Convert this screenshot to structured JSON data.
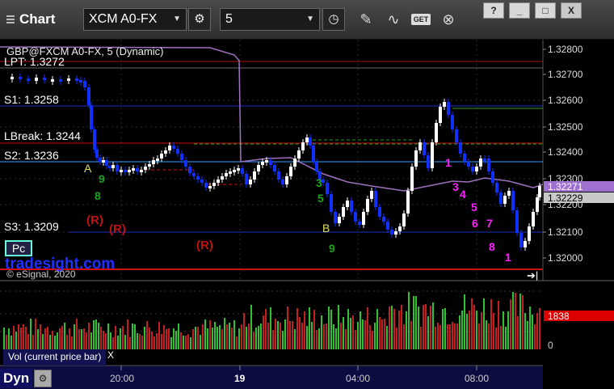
{
  "window": {
    "title": "Chart",
    "symbol": "XCM A0-FX",
    "interval": "5",
    "buttons": {
      "minimize": "_",
      "restore": "□",
      "close": "X",
      "help": "?"
    },
    "icons": [
      "gear-icon",
      "clock-icon",
      "pencil-icon",
      "chart-line-icon",
      "get-icon",
      "close-circle-icon"
    ]
  },
  "chart": {
    "header": "GBP@FXCM A0-FX, 5 (Dynamic)",
    "price_levels": [
      "1.32800",
      "1.32700",
      "1.32600",
      "1.32500",
      "1.32400",
      "1.32300",
      "1.32200",
      "1.32100",
      "1.32000"
    ],
    "price_tags": {
      "last": "1.32271",
      "second": "1.32229",
      "volume": "1838"
    },
    "level_labels": {
      "lpt": "LPT: 1.3272",
      "s1": "S1: 1.3258",
      "lbreak": "LBreak: 1.3244",
      "s2": "S2: 1.3236",
      "s3": "S3: 1.3209"
    },
    "time_labels": [
      "20:00",
      "19",
      "04:00",
      "08:00"
    ],
    "markers": {
      "A": "A",
      "B": "B",
      "R": "(R)"
    },
    "watermark": "tradesight.com",
    "copyright": "© eSignal, 2020",
    "pc_box": "Pc",
    "volume_label": "Vol (current price bar)",
    "volume_close": "X",
    "volume_zero": "0",
    "dyn_label": "Dyn"
  },
  "colors": {
    "candle_up": "#ffffff",
    "candle_down": "#1030ff",
    "resistance": "#cc1010",
    "support": "#2030c0",
    "green_line": "#20a020",
    "ma_purple": "#a070c0",
    "magenta": "#ff20ff"
  }
}
